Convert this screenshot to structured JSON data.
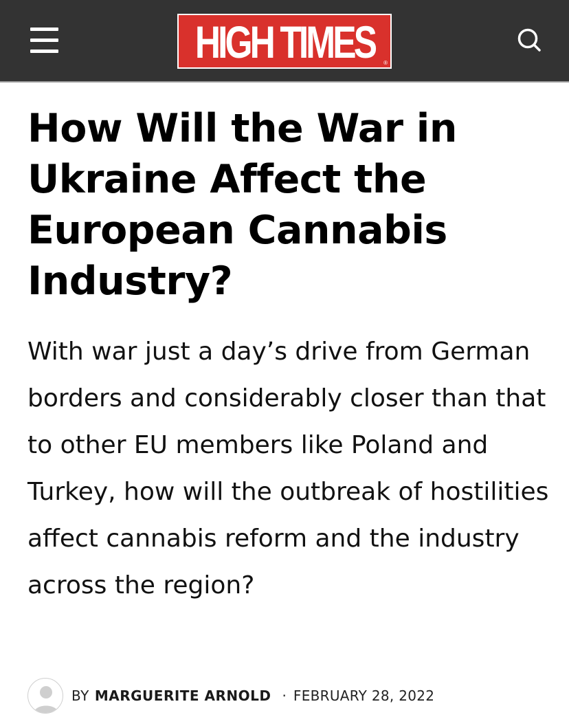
{
  "header": {
    "logo_text": "HIGH TIMES",
    "logo_registered": "®",
    "menu_icon": "hamburger-menu-icon",
    "search_icon": "search-icon",
    "background_color": "#333333",
    "logo_color": "#d9312c"
  },
  "article": {
    "title": "How Will the War in Ukraine Affect the European Cannabis Industry?",
    "dek": "With war just a day’s drive from German borders and considerably closer than that to other EU members like Poland and Turkey, how will the outbreak of hostilities affect cannabis reform and the industry across the region?",
    "byline": {
      "avatar_icon": "user-avatar-icon",
      "by_label": "BY",
      "author": "MARGUERITE ARNOLD",
      "separator": "·",
      "date": "FEBRUARY 28, 2022"
    }
  }
}
